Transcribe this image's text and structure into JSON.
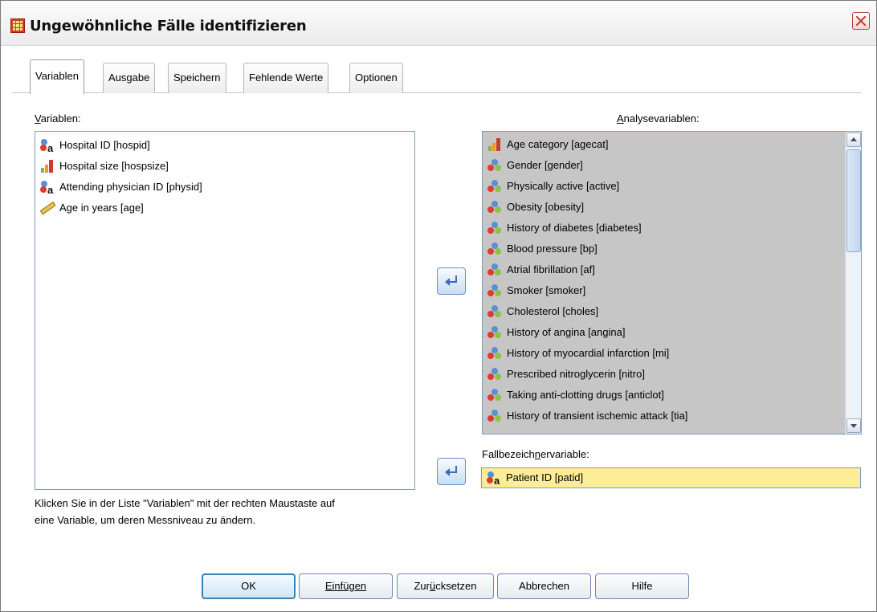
{
  "window": {
    "title": "Ungewöhnliche Fälle identifizieren"
  },
  "tabs": [
    {
      "label": "Variablen",
      "active": true
    },
    {
      "label": "Ausgabe",
      "active": false
    },
    {
      "label": "Speichern",
      "active": false
    },
    {
      "label": "Fehlende Werte",
      "active": false
    },
    {
      "label": "Optionen",
      "active": false
    }
  ],
  "source": {
    "label": "Variablen:",
    "items": [
      {
        "label": "Hospital ID [hospid]",
        "icon": "nominal-string-icon"
      },
      {
        "label": "Hospital size [hospsize]",
        "icon": "ordinal-icon"
      },
      {
        "label": "Attending physician ID [physid]",
        "icon": "nominal-string-icon"
      },
      {
        "label": "Age in years [age]",
        "icon": "scale-icon"
      }
    ]
  },
  "hint": {
    "line1": "Klicken Sie in der Liste \"Variablen\" mit der rechten Maustaste auf",
    "line2": "eine Variable, um deren Messniveau zu ändern."
  },
  "analysis": {
    "label": "Analysevariablen:",
    "items": [
      {
        "label": "Age category [agecat]",
        "icon": "ordinal-icon"
      },
      {
        "label": "Gender [gender]",
        "icon": "nominal-icon"
      },
      {
        "label": "Physically active [active]",
        "icon": "nominal-icon"
      },
      {
        "label": "Obesity [obesity]",
        "icon": "nominal-icon"
      },
      {
        "label": "History of diabetes [diabetes]",
        "icon": "nominal-icon"
      },
      {
        "label": "Blood pressure [bp]",
        "icon": "nominal-icon"
      },
      {
        "label": "Atrial fibrillation [af]",
        "icon": "nominal-icon"
      },
      {
        "label": "Smoker [smoker]",
        "icon": "nominal-icon"
      },
      {
        "label": "Cholesterol [choles]",
        "icon": "nominal-icon"
      },
      {
        "label": "History of angina [angina]",
        "icon": "nominal-icon"
      },
      {
        "label": "History of myocardial infarction [mi]",
        "icon": "nominal-icon"
      },
      {
        "label": "Prescribed nitroglycerin [nitro]",
        "icon": "nominal-icon"
      },
      {
        "label": "Taking anti-clotting drugs [anticlot]",
        "icon": "nominal-icon"
      },
      {
        "label": "History of transient ischemic attack [tia]",
        "icon": "nominal-icon"
      }
    ]
  },
  "caseid": {
    "label": "Fallbezeichnervariable:",
    "value": "Patient ID [patid]",
    "icon": "nominal-string-icon"
  },
  "buttons": {
    "ok": "OK",
    "paste": "Einfügen",
    "reset": "Zurücksetzen",
    "cancel": "Abbrechen",
    "help": "Hilfe"
  }
}
